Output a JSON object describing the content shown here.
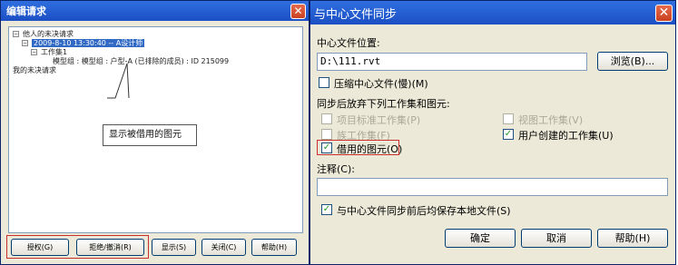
{
  "left_dialog": {
    "title": "编辑请求",
    "close_glyph": "✕",
    "tree": {
      "node_root": "他人的未决请求",
      "node_request": "2009-8-10 13:30:40 -- A设计师",
      "node_workset": "工作集1",
      "node_element": "模型组 : 模型组 : 户型-A (已排除的成员) : ID 215099",
      "node_mine": "我的未决请求"
    },
    "callout_text": "显示被借用的图元",
    "buttons": {
      "grant": "授权(G)",
      "reject": "拒绝/撤消(R)",
      "show": "显示(S)",
      "close": "关闭(C)",
      "help": "帮助(H)"
    }
  },
  "right_dialog": {
    "title": "与中心文件同步",
    "close_glyph": "✕",
    "central_location_label": "中心文件位置:",
    "central_location_value": "D:\\111.rvt",
    "browse_button": "浏览(B)...",
    "compress_label": "压缩中心文件(慢)(M)",
    "relinquish_heading": "同步后放弃下列工作集和图元:",
    "worksets": {
      "project_standards": "项目标准工作集(P)",
      "view_worksets": "视图工作集(V)",
      "family_worksets": "族工作集(F)",
      "user_created": "用户创建的工作集(U)",
      "borrowed_elements": "借用的图元(O)"
    },
    "comment_label": "注释(C):",
    "comment_value": "",
    "save_local_label": "与中心文件同步前后均保存本地文件(S)",
    "buttons": {
      "ok": "确定",
      "cancel": "取消",
      "help": "帮助(H)"
    },
    "check_glyph": "✓"
  }
}
